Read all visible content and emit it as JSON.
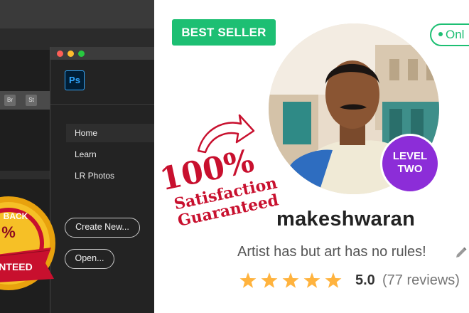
{
  "photoshop": {
    "app_tiles": [
      "Br",
      "St"
    ],
    "logo_text": "Ps",
    "nav": [
      "Home",
      "Learn",
      "LR Photos"
    ],
    "create_button": "Create New...",
    "open_button": "Open...",
    "badge_top_text": "BACK",
    "badge_mid_text": "%",
    "badge_ribbon_text": "NTEED"
  },
  "profile": {
    "best_seller": "BEST SELLER",
    "online": "Onl",
    "level_line1": "LEVEL",
    "level_line2": "TWO",
    "stamp_percent": "100%",
    "stamp_line1": "Satisfaction",
    "stamp_line2": "Guaranteed",
    "username": "makeshwaran",
    "tagline": "Artist has but art has no rules!",
    "rating_value": "5.0",
    "reviews_text": "(77 reviews)",
    "star_count": 5,
    "colors": {
      "brand_green": "#1dbf73",
      "level_purple": "#8c2dd8",
      "star_gold": "#ffb33e",
      "stamp_red": "#c8102e",
      "ps_blue": "#31a8ff"
    }
  }
}
